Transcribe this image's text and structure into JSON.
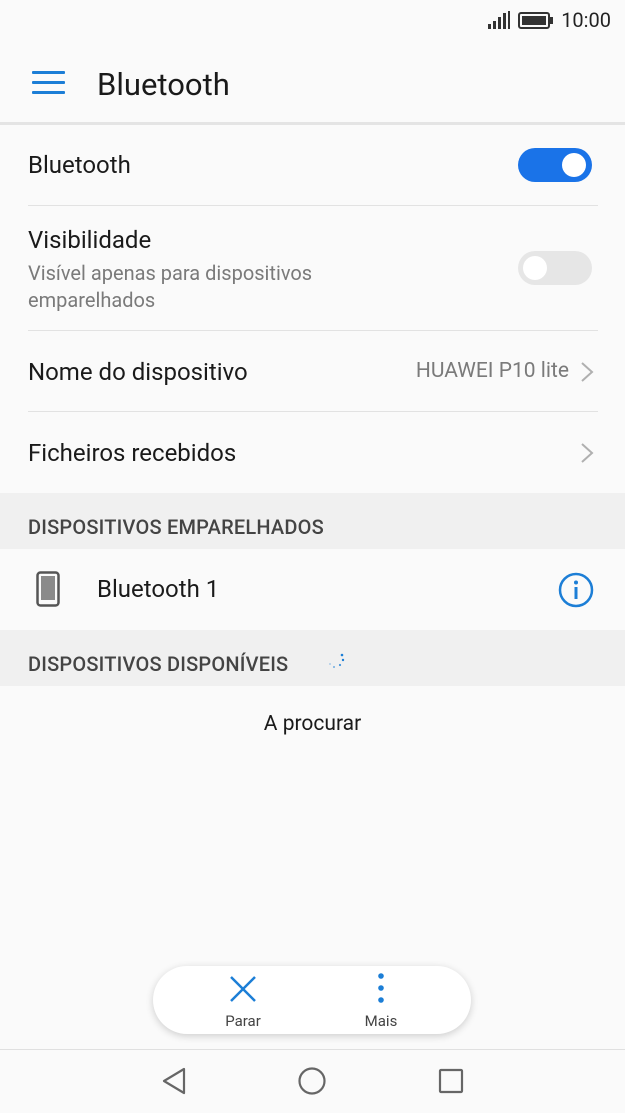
{
  "status_bar": {
    "time": "10:00"
  },
  "app_bar": {
    "title": "Bluetooth",
    "menu_icon": "menu-icon"
  },
  "settings": {
    "bluetooth": {
      "label": "Bluetooth",
      "enabled": true
    },
    "visibility": {
      "label": "Visibilidade",
      "subtitle_line1": "Visível apenas para dispositivos",
      "subtitle_line2": "emparelhados",
      "enabled": false
    },
    "device_name": {
      "label": "Nome do dispositivo",
      "value": "HUAWEI P10 lite"
    },
    "received_files": {
      "label": "Ficheiros recebidos"
    }
  },
  "paired_section": {
    "header": "DISPOSITIVOS EMPARELHADOS",
    "devices": [
      {
        "name": "Bluetooth 1",
        "icon": "phone-icon",
        "action_icon": "info-icon"
      }
    ]
  },
  "available_section": {
    "header": "DISPOSITIVOS DISPONÍVEIS",
    "status": "A procurar"
  },
  "actions": {
    "stop": {
      "label": "Parar",
      "icon": "close-icon"
    },
    "more": {
      "label": "Mais",
      "icon": "more-vertical-icon"
    }
  },
  "colors": {
    "accent": "#1a73e8",
    "icon_blue": "#1c7ed6"
  }
}
